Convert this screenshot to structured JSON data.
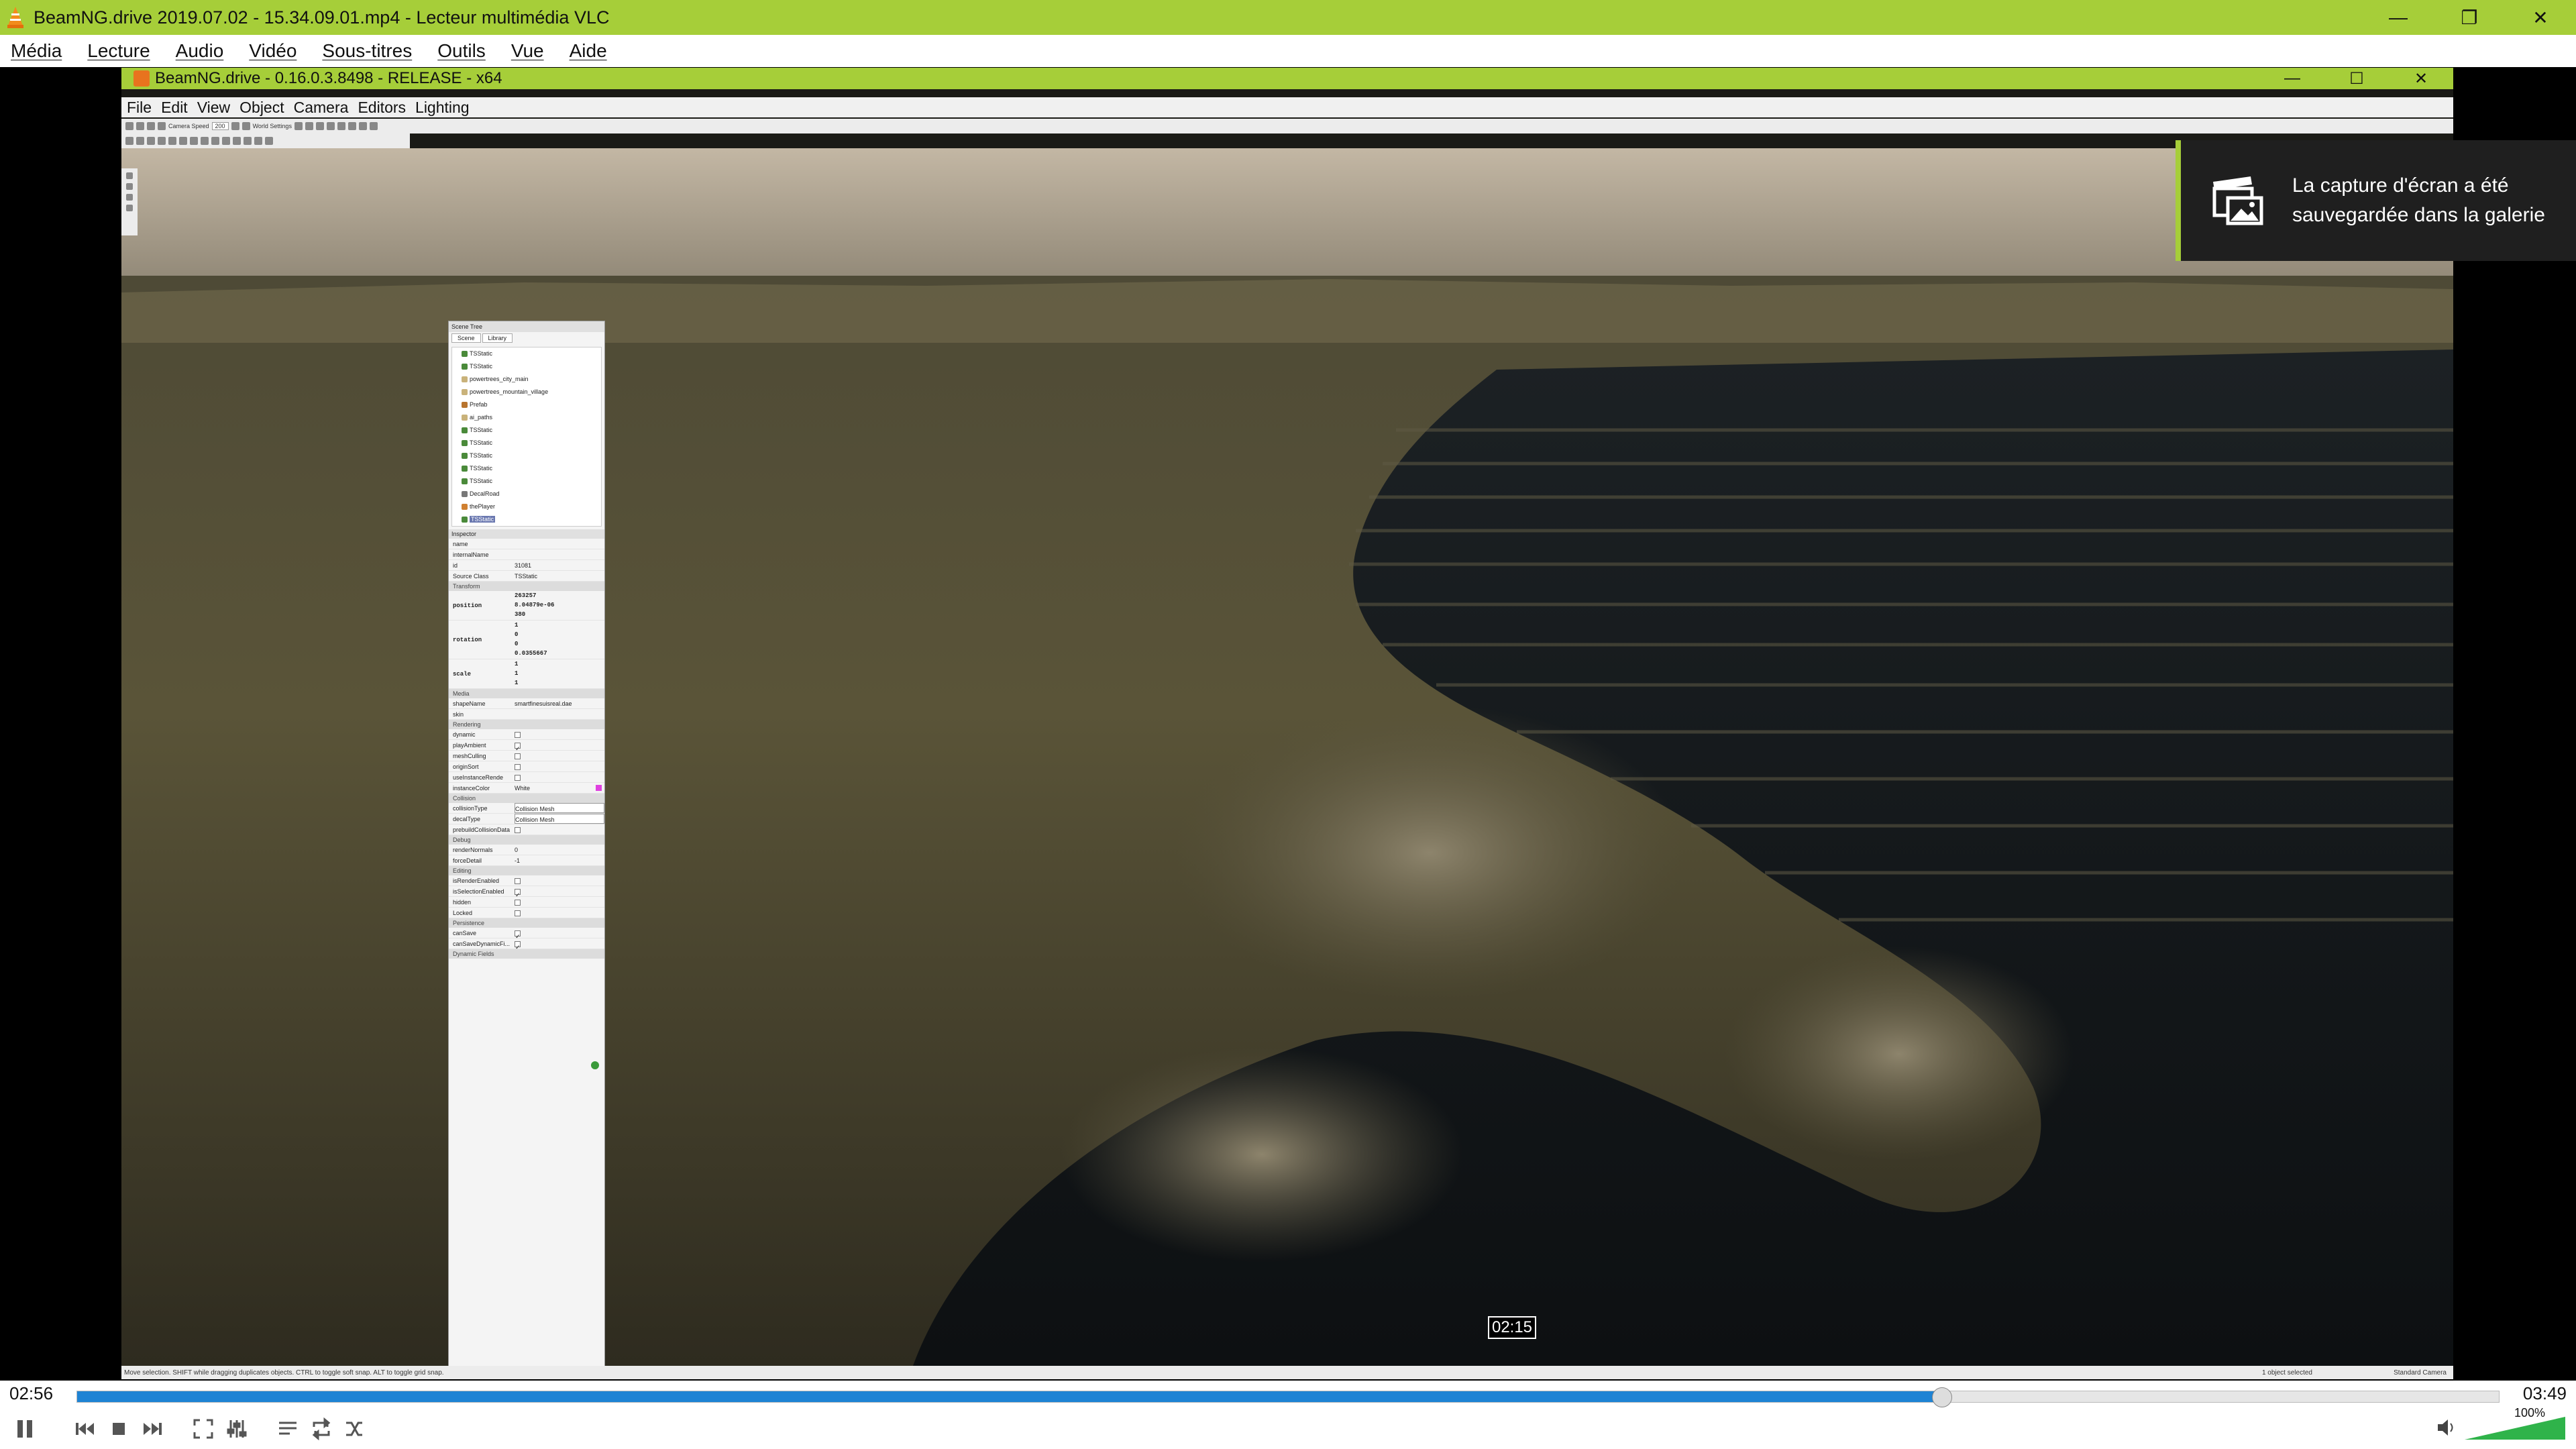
{
  "vlc": {
    "title": "BeamNG.drive 2019.07.02 - 15.34.09.01.mp4 - Lecteur multimédia VLC",
    "menu": [
      "Média",
      "Lecture",
      "Audio",
      "Vidéo",
      "Sous-titres",
      "Outils",
      "Vue",
      "Aide"
    ],
    "elapsed": "02:56",
    "total": "03:49",
    "progress": 0.77,
    "hover_time": "02:15",
    "volume_label": "100%",
    "volume": 1.0,
    "accent": "#a6ce39",
    "seek_color": "#1e83d4"
  },
  "notification": {
    "text": "La capture d'écran a été sauvegardée dans la galerie"
  },
  "beamng": {
    "title": "BeamNG.drive - 0.16.0.3.8498 - RELEASE - x64",
    "menu": [
      "File",
      "Edit",
      "View",
      "Object",
      "Camera",
      "Editors",
      "Lighting"
    ],
    "toolbar": {
      "camera_speed_label": "Camera Speed",
      "camera_speed_value": "200",
      "world_settings": "World Settings"
    },
    "status_left": "Move selection.  SHIFT while dragging duplicates objects.  CTRL to toggle soft snap.  ALT to toggle grid snap.",
    "status_mid": "1 object selected",
    "status_right": "Standard Camera",
    "scene_tree": {
      "title": "Scene Tree",
      "tabs": [
        "Scene",
        "Library"
      ],
      "nodes": [
        "TSStatic",
        "TSStatic",
        "powertrees_city_main",
        "powertrees_mountain_village",
        "Prefab",
        "ai_paths",
        "TSStatic",
        "TSStatic",
        "TSStatic",
        "TSStatic",
        "TSStatic",
        "DecalRoad",
        "thePlayer",
        "TSStatic"
      ]
    },
    "inspector": {
      "title": "Inspector",
      "fields": [
        {
          "k": "name",
          "v": ""
        },
        {
          "k": "internalName",
          "v": ""
        },
        {
          "k": "id",
          "v": "31081"
        },
        {
          "k": "Source Class",
          "v": "TSStatic"
        }
      ],
      "transform_label": "Transform",
      "position_label": "position",
      "position": [
        "263257",
        "8.04879e-06",
        "380"
      ],
      "rotation_label": "rotation",
      "rotation": [
        "1",
        "0",
        "0",
        "0.0355667"
      ],
      "scale_label": "scale",
      "scale": [
        "1",
        "1",
        "1"
      ],
      "media_label": "Media",
      "shape_name_label": "shapeName",
      "shape_name_value": "smartfinesuisreal.dae",
      "skin_label": "skin",
      "rendering_label": "Rendering",
      "rendering": [
        "dynamic",
        "playAmbient",
        "meshCulling",
        "originSort",
        "useInstanceRende"
      ],
      "instance_color_label": "instanceColor",
      "instance_color_value": "White",
      "collision_label": "Collision",
      "collision_type_label": "collisionType",
      "collision_type_value": "Collision Mesh",
      "decal_type_label": "decalType",
      "decal_type_value": "Collision Mesh",
      "prebuild_label": "prebuildCollisionData",
      "debug_label": "Debug",
      "render_normals_label": "renderNormals",
      "render_normals_value": "0",
      "force_detail_label": "forceDetail",
      "force_detail_value": "-1",
      "editing_label": "Editing",
      "editing": [
        "isRenderEnabled",
        "isSelectionEnabled",
        "hidden",
        "Locked"
      ],
      "persistence_label": "Persistence",
      "persistence": [
        "canSave",
        "canSaveDynamicFi..."
      ],
      "dynamic_label": "Dynamic Fields"
    }
  }
}
